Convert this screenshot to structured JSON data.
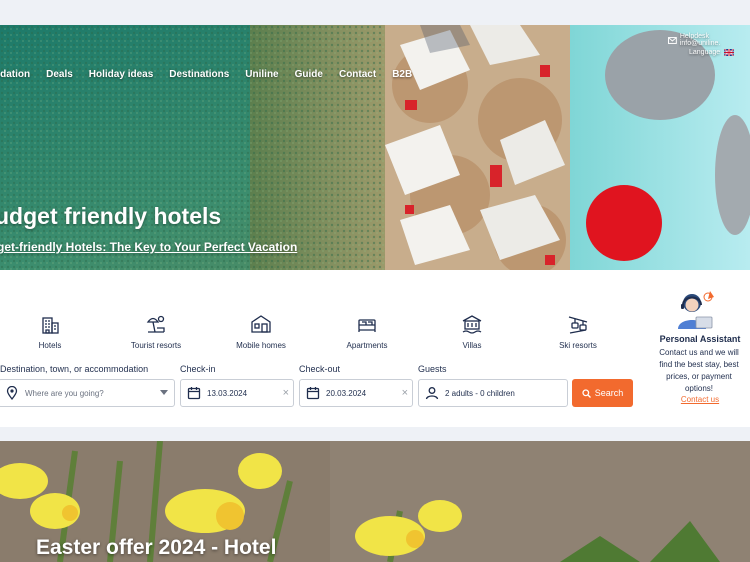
{
  "nav": {
    "items": [
      "odation",
      "Deals",
      "Holiday ideas",
      "Destinations",
      "Uniline",
      "Guide",
      "Contact",
      "B2B"
    ]
  },
  "header": {
    "helpdesk": "Helpdesk info@uniline.",
    "language_label": "Language"
  },
  "hero": {
    "title": "udget friendly hotels",
    "subtitle": "get-friendly Hotels: The Key to Your Perfect Vacation"
  },
  "categories": [
    {
      "label": "Hotels",
      "icon": "hotel-icon"
    },
    {
      "label": "Tourist resorts",
      "icon": "tourist-resort-icon"
    },
    {
      "label": "Mobile homes",
      "icon": "mobile-home-icon"
    },
    {
      "label": "Apartments",
      "icon": "apartment-icon"
    },
    {
      "label": "Villas",
      "icon": "villa-icon"
    },
    {
      "label": "Ski resorts",
      "icon": "ski-resort-icon"
    }
  ],
  "search": {
    "destination_label": "Destination, town, or accommodation",
    "destination_placeholder": "Where are you going?",
    "checkin_label": "Check-in",
    "checkin_value": "13.03.2024",
    "checkout_label": "Check-out",
    "checkout_value": "20.03.2024",
    "guests_label": "Guests",
    "guests_value": "2 adults - 0 children",
    "button_label": "Search",
    "clear_symbol": "×"
  },
  "assistant": {
    "title": "Personal Assistant",
    "text": "Contact us and we will find the best stay, best prices, or payment options!",
    "link": "Contact us"
  },
  "offer": {
    "title": "Easter offer 2024 - Hotel"
  },
  "colors": {
    "accent": "#f26a2e",
    "navy": "#1f2d4d",
    "page_bg": "#eef1f6"
  }
}
